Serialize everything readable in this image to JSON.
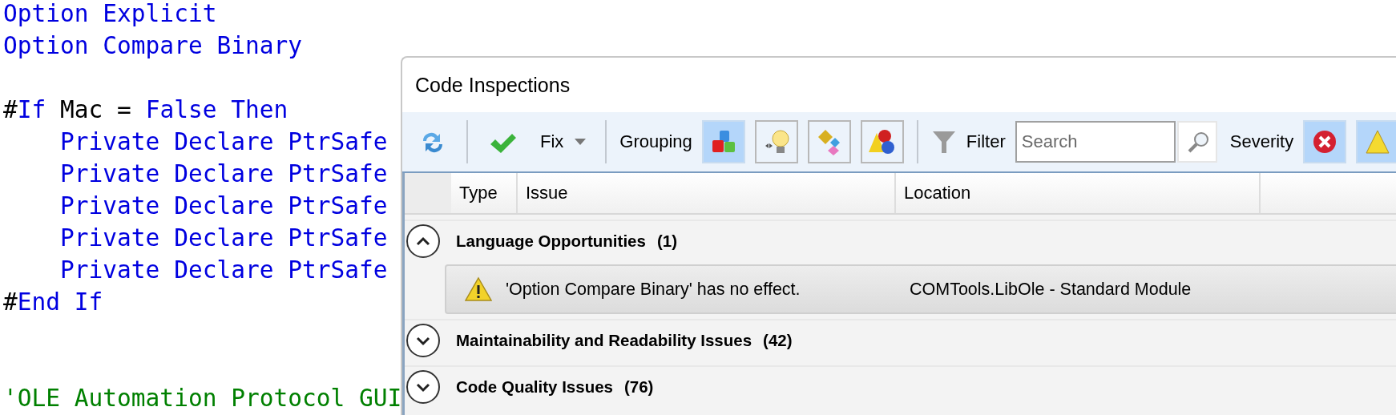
{
  "code_lines": [
    {
      "tokens": [
        {
          "text": "Option Explicit",
          "kind": "keyword"
        }
      ]
    },
    {
      "tokens": [
        {
          "text": "Option Compare Binary",
          "kind": "keyword"
        }
      ]
    },
    {
      "kind": "blank"
    },
    {
      "tokens": [
        {
          "text": "#",
          "kind": "plain"
        },
        {
          "text": "If",
          "kind": "keyword"
        },
        {
          "text": " Mac = ",
          "kind": "plain"
        },
        {
          "text": "False Then",
          "kind": "keyword"
        }
      ]
    },
    {
      "tokens": [
        {
          "text": "    Private Declare PtrSafe",
          "kind": "keyword"
        }
      ]
    },
    {
      "tokens": [
        {
          "text": "    Private Declare PtrSafe",
          "kind": "keyword"
        }
      ]
    },
    {
      "tokens": [
        {
          "text": "    Private Declare PtrSafe",
          "kind": "keyword"
        }
      ]
    },
    {
      "tokens": [
        {
          "text": "    Private Declare PtrSafe",
          "kind": "keyword"
        }
      ]
    },
    {
      "tokens": [
        {
          "text": "    Private Declare PtrSafe",
          "kind": "keyword"
        }
      ]
    },
    {
      "tokens": [
        {
          "text": "#",
          "kind": "plain"
        },
        {
          "text": "End If",
          "kind": "keyword"
        }
      ]
    },
    {
      "kind": "blank"
    },
    {
      "kind": "blank"
    },
    {
      "tokens": [
        {
          "text": "'OLE Automation Protocol GUI",
          "kind": "comment"
        }
      ]
    }
  ],
  "window": {
    "title": "Code Inspections"
  },
  "toolbar": {
    "fix_label": "Fix",
    "grouping_label": "Grouping",
    "grouping_buttons": [
      {
        "selected": true
      },
      {
        "selected": false
      },
      {
        "selected": false
      },
      {
        "selected": false
      }
    ],
    "filter_label": "Filter",
    "search": {
      "placeholder": "Search"
    },
    "severity_label": "Severity",
    "severity_buttons": [
      {
        "selected": true
      },
      {
        "selected": true
      }
    ]
  },
  "table": {
    "columns": [
      "Type",
      "Issue",
      "Location"
    ],
    "groups": [
      {
        "title": "Language Opportunities",
        "count": "(1)",
        "expanded": true,
        "issues": [
          {
            "message": "'Option Compare Binary' has no effect.",
            "location": "COMTools.LibOle - Standard Module"
          }
        ]
      },
      {
        "title": "Maintainability and Readability Issues",
        "count": "(42)",
        "expanded": false
      },
      {
        "title": "Code Quality Issues",
        "count": "(76)",
        "expanded": false
      }
    ]
  }
}
